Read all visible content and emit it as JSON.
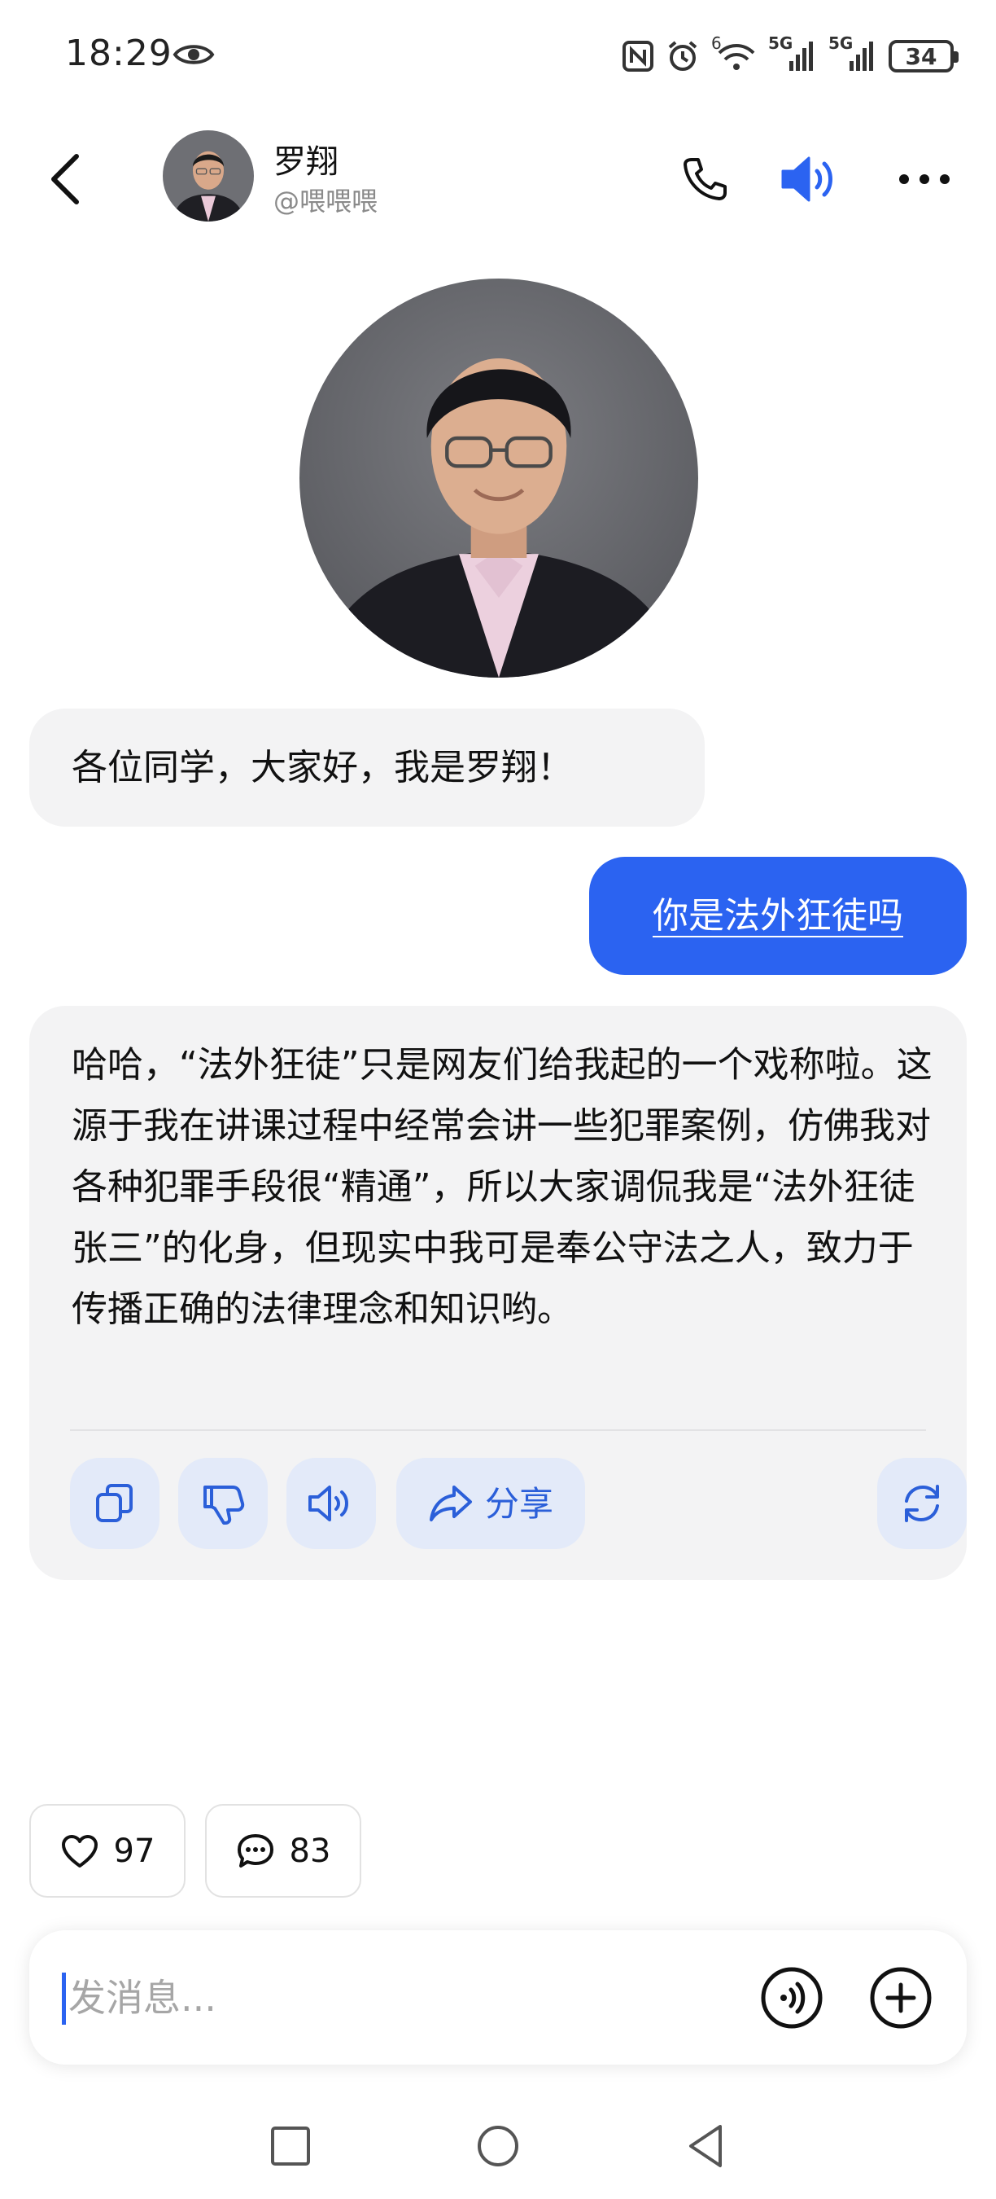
{
  "status_bar": {
    "time": "18:29",
    "battery": "34",
    "net1": "5G",
    "net2": "5G",
    "wifi_badge": "6"
  },
  "header": {
    "name": "罗翔",
    "handle": "@喂喂喂"
  },
  "messages": {
    "greeting": "各位同学，大家好，我是罗翔！",
    "user_question": "你是法外狂徒吗",
    "bot_reply": "哈哈，“法外狂徒”只是网友们给我起的一个戏称啦。这源于我在讲课过程中经常会讲一些犯罪案例，仿佛我对各种犯罪手段很“精通”，所以大家调侃我是“法外狂徒张三”的化身，但现实中我可是奉公守法之人，致力于传播正确的法律理念和知识哟。"
  },
  "actions": {
    "share_label": "分享"
  },
  "reactions": {
    "likes": "97",
    "comments": "83"
  },
  "input": {
    "placeholder": "发消息..."
  },
  "colors": {
    "accent": "#2b63f1",
    "bubble_bg": "#f3f3f4",
    "action_bg": "#e3eaf9"
  },
  "icons": {
    "back": "chevron-left-icon",
    "call": "phone-icon",
    "speaker": "speaker-icon",
    "more": "more-icon",
    "copy": "copy-icon",
    "dislike": "thumbs-down-icon",
    "speak": "speaker-icon",
    "share": "share-icon",
    "regenerate": "refresh-icon",
    "like": "heart-icon",
    "comment": "comment-icon",
    "voice": "voice-icon",
    "plus": "plus-icon"
  }
}
